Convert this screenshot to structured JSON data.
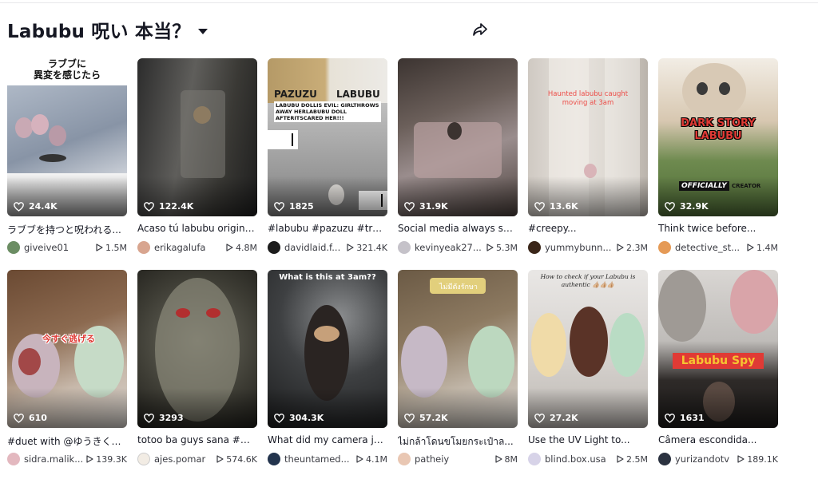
{
  "header": {
    "title": "Labubu 呪い 本当？"
  },
  "videos": [
    {
      "likes": "24.4K",
      "description": "ラブブを持つと呪われる...",
      "author": "giveive01",
      "plays": "1.5M",
      "overlay": "ラブブに\n異変を感じたら"
    },
    {
      "likes": "122.4K",
      "description": "Acaso tú labubu origina...",
      "author": "erikagalufa",
      "plays": "4.8M"
    },
    {
      "likes": "1825",
      "description": "#labubu #pazuzu #tren...",
      "author": "davidlaid.f...",
      "plays": "321.4K",
      "overlay_left": "PAZUZU",
      "overlay_right": "LABUBU",
      "overlay": "LABUBU DOLLIS EVIL: GIRLTHROWS AWAY HERLABUBU DOLL AFTERITSCARED HER!!!"
    },
    {
      "likes": "31.9K",
      "description": "Social media always sai...",
      "author": "kevinyeak27...",
      "plays": "5.3M"
    },
    {
      "likes": "13.6K",
      "description": "#creepy...",
      "author": "yummybunn...",
      "plays": "2.3M",
      "overlay": "Haunted labubu caught moving at 3am"
    },
    {
      "likes": "32.9K",
      "description": "Think twice before...",
      "author": "detective_st...",
      "plays": "1.4M",
      "overlay": "DARK STORY\nLABUBU",
      "overlay2": "OFFICIALLY",
      "overlay3": "CREATOR"
    },
    {
      "likes": "610",
      "description": "#duet with @ゆうきくん...",
      "author": "sidra.malik...",
      "plays": "139.3K",
      "overlay": "今すぐ逃げる"
    },
    {
      "likes": "3293",
      "description": "totoo ba guys sana #m...",
      "author": "ajes.pomar",
      "plays": "574.6K"
    },
    {
      "likes": "304.3K",
      "description": "What did my camera jus...",
      "author": "theuntamed...",
      "plays": "4.1M",
      "overlay": "What is this at 3am??"
    },
    {
      "likes": "57.2K",
      "description": "ไม่กล้าโดนขโมยกระเป๋าล...",
      "author": "patheiy",
      "plays": "8M",
      "overlay": "ไม่มีตังรักษา"
    },
    {
      "likes": "27.2K",
      "description": "Use the UV Light to...",
      "author": "blind.box.usa",
      "plays": "2.5M",
      "overlay": "How to check if your Labubu is authentic 👍🏼👍🏼👍🏼"
    },
    {
      "likes": "1631",
      "description": "Câmera escondida...",
      "author": "yurizandotv",
      "plays": "189.1K",
      "overlay": "Labubu Spy"
    }
  ],
  "icons": {
    "likes": "heart-outline-icon",
    "plays": "play-outline-icon",
    "share": "share-arrow-icon",
    "title_dropdown": "caret-down-icon"
  },
  "colors": {
    "text": "#161823",
    "secondary_text": "#3a3b42",
    "background": "#ffffff",
    "overlay_red": "#e03a35",
    "overlay_yellow": "#f6c531"
  }
}
